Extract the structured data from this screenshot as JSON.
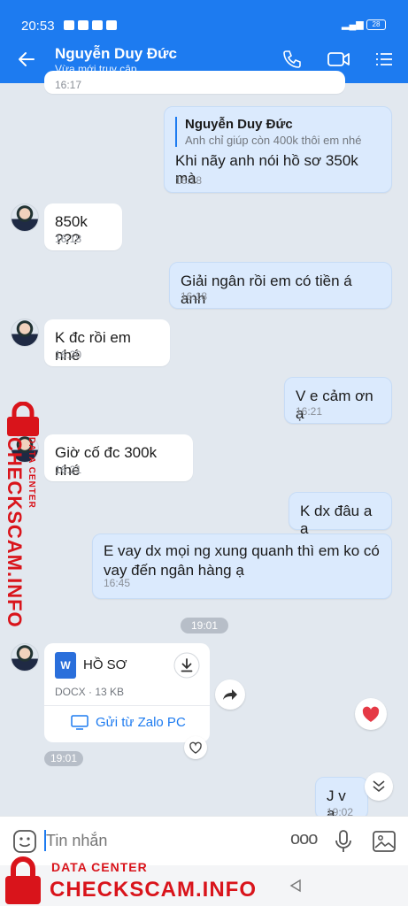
{
  "status_bar": {
    "time": "20:53",
    "battery": "28"
  },
  "header": {
    "contact_name": "Nguyễn Duy Đức",
    "status": "Vừa mới truy cập"
  },
  "messages": [
    {
      "sender": "other",
      "text": "",
      "time": "16:17"
    },
    {
      "sender": "me",
      "quote_name": "Nguyễn Duy Đức",
      "quote_text": "Anh chỉ giúp còn 400k thôi em nhé",
      "text": "Khi nãy anh nói hồ sơ 350k mà",
      "time": "16:18"
    },
    {
      "sender": "other",
      "text": "850k ???",
      "time": "16:18"
    },
    {
      "sender": "me",
      "text": "Giải ngân rồi em có tiền á anh",
      "time": "16:18"
    },
    {
      "sender": "other",
      "text": "K đc rồi em nhé",
      "time": "16:20"
    },
    {
      "sender": "me",
      "text": "V e cảm ơn ạ",
      "time": "16:21"
    },
    {
      "sender": "other",
      "text": "Giờ cố đc 300k nhé",
      "time": "16:21"
    },
    {
      "sender": "me",
      "text": "K dx đâu a ạ",
      "time": ""
    },
    {
      "sender": "me",
      "text": "E vay dx mọi ng xung quanh thì em ko có vay đến ngân hàng ạ",
      "time": "16:45"
    },
    {
      "sender": "me",
      "text": "J v ạ",
      "time": "19:02"
    }
  ],
  "time_divider": "19:01",
  "file_message": {
    "file_name": "HỒ SƠ",
    "file_meta": "DOCX · 13 KB",
    "doc_icon_letter": "W",
    "source_label": "Gửi từ Zalo PC",
    "time": "19:01"
  },
  "input": {
    "placeholder": "Tin nhắn",
    "more_label": "ooo"
  },
  "watermark": {
    "top_label": "DATA CENTER",
    "brand": "CHECKSCAM.INFO"
  },
  "colors": {
    "accent": "#1d7bf0",
    "my_bubble": "#dbeafd",
    "background": "#e2e8ef",
    "watermark": "#d9141b",
    "heart": "#e53945"
  }
}
